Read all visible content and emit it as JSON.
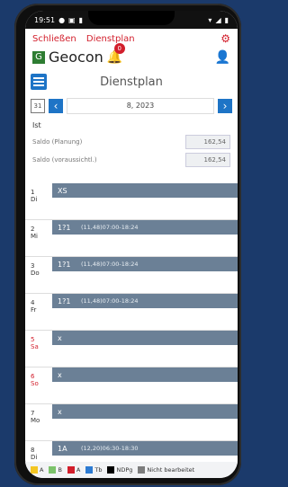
{
  "status_bar": {
    "time": "19:51",
    "left_icons": [
      "notif-icon",
      "image-icon",
      "battery-icon"
    ],
    "right_icons": [
      "wifi-icon",
      "signal-icon",
      "battery-icon"
    ]
  },
  "top_nav": {
    "close": "Schließen",
    "schedule": "Dienstplan",
    "gear_icon": "gear-icon"
  },
  "brand": {
    "name": "Geocon",
    "logo_letter": "G",
    "bell_badge": "0"
  },
  "header": {
    "title": "Dienstplan"
  },
  "date_nav": {
    "calendar_label": "31",
    "month": "8, 2023"
  },
  "summary": {
    "section": "Ist",
    "items": [
      {
        "label": "Saldo (Planung)",
        "value": "162,54"
      },
      {
        "label": "Saldo (voraussichtl.)",
        "value": "162,54"
      }
    ]
  },
  "days": [
    {
      "num": "1",
      "dow": "Di",
      "code": "XS",
      "text": ""
    },
    {
      "num": "2",
      "dow": "Mi",
      "code": "1?1",
      "text": "(11,48)07:00-18:24"
    },
    {
      "num": "3",
      "dow": "Do",
      "code": "1?1",
      "text": "(11,48)07:00-18:24"
    },
    {
      "num": "4",
      "dow": "Fr",
      "code": "1?1",
      "text": "(11,48)07:00-18:24"
    },
    {
      "num": "5",
      "dow": "Sa",
      "code": "x",
      "text": ""
    },
    {
      "num": "6",
      "dow": "So",
      "code": "x",
      "text": ""
    },
    {
      "num": "7",
      "dow": "Mo",
      "code": "x",
      "text": ""
    },
    {
      "num": "8",
      "dow": "Di",
      "code": "1A",
      "text": "(12,20)06:30-18:30"
    }
  ],
  "legend": [
    {
      "label": "A",
      "color": "#f3c623"
    },
    {
      "label": "B",
      "color": "#7cc36b"
    },
    {
      "label": "A",
      "color": "#d21e2b"
    },
    {
      "label": "Tb",
      "color": "#2d7bd2"
    },
    {
      "label": "NDPg",
      "color": "#000000"
    },
    {
      "label": "Nicht bearbeitet",
      "color": "#7d7d7d"
    }
  ]
}
